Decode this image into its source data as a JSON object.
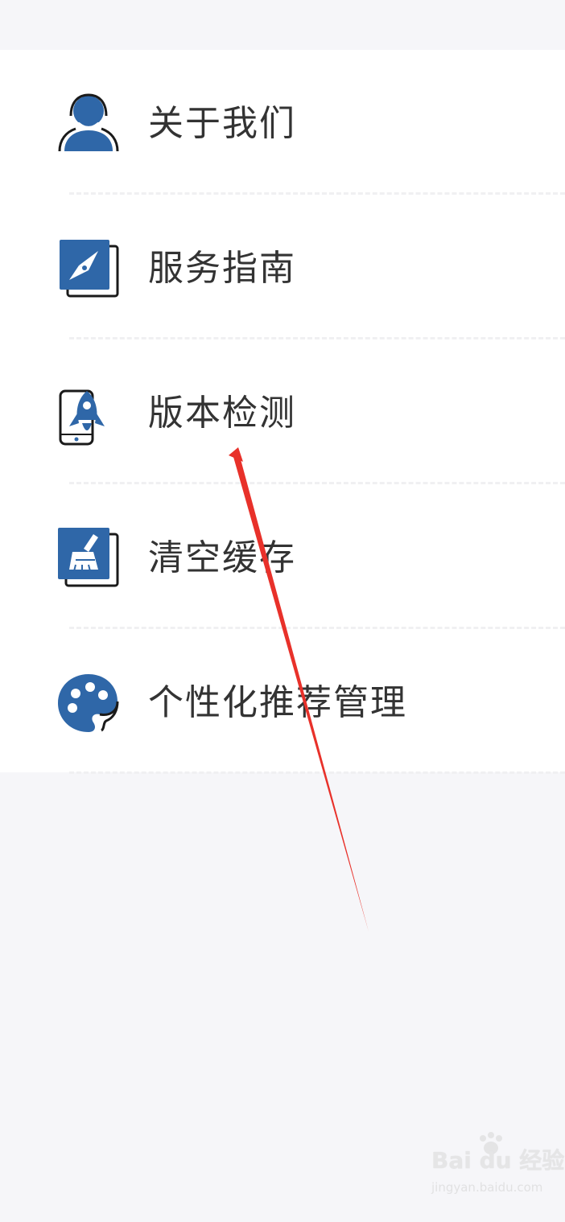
{
  "menu": {
    "items": [
      {
        "label": "关于我们",
        "icon": "user-support-icon"
      },
      {
        "label": "服务指南",
        "icon": "compass-icon"
      },
      {
        "label": "版本检测",
        "icon": "rocket-icon"
      },
      {
        "label": "清空缓存",
        "icon": "broom-icon"
      },
      {
        "label": "个性化推荐管理",
        "icon": "palette-icon"
      }
    ]
  },
  "colors": {
    "accent": "#2f67a8",
    "text": "#333333",
    "background": "#f6f6f9",
    "card": "#ffffff",
    "annotation_arrow": "#e8312a"
  },
  "watermark": {
    "logo_text": "Bai du 经验",
    "url_text": "jingyan.baidu.com"
  }
}
